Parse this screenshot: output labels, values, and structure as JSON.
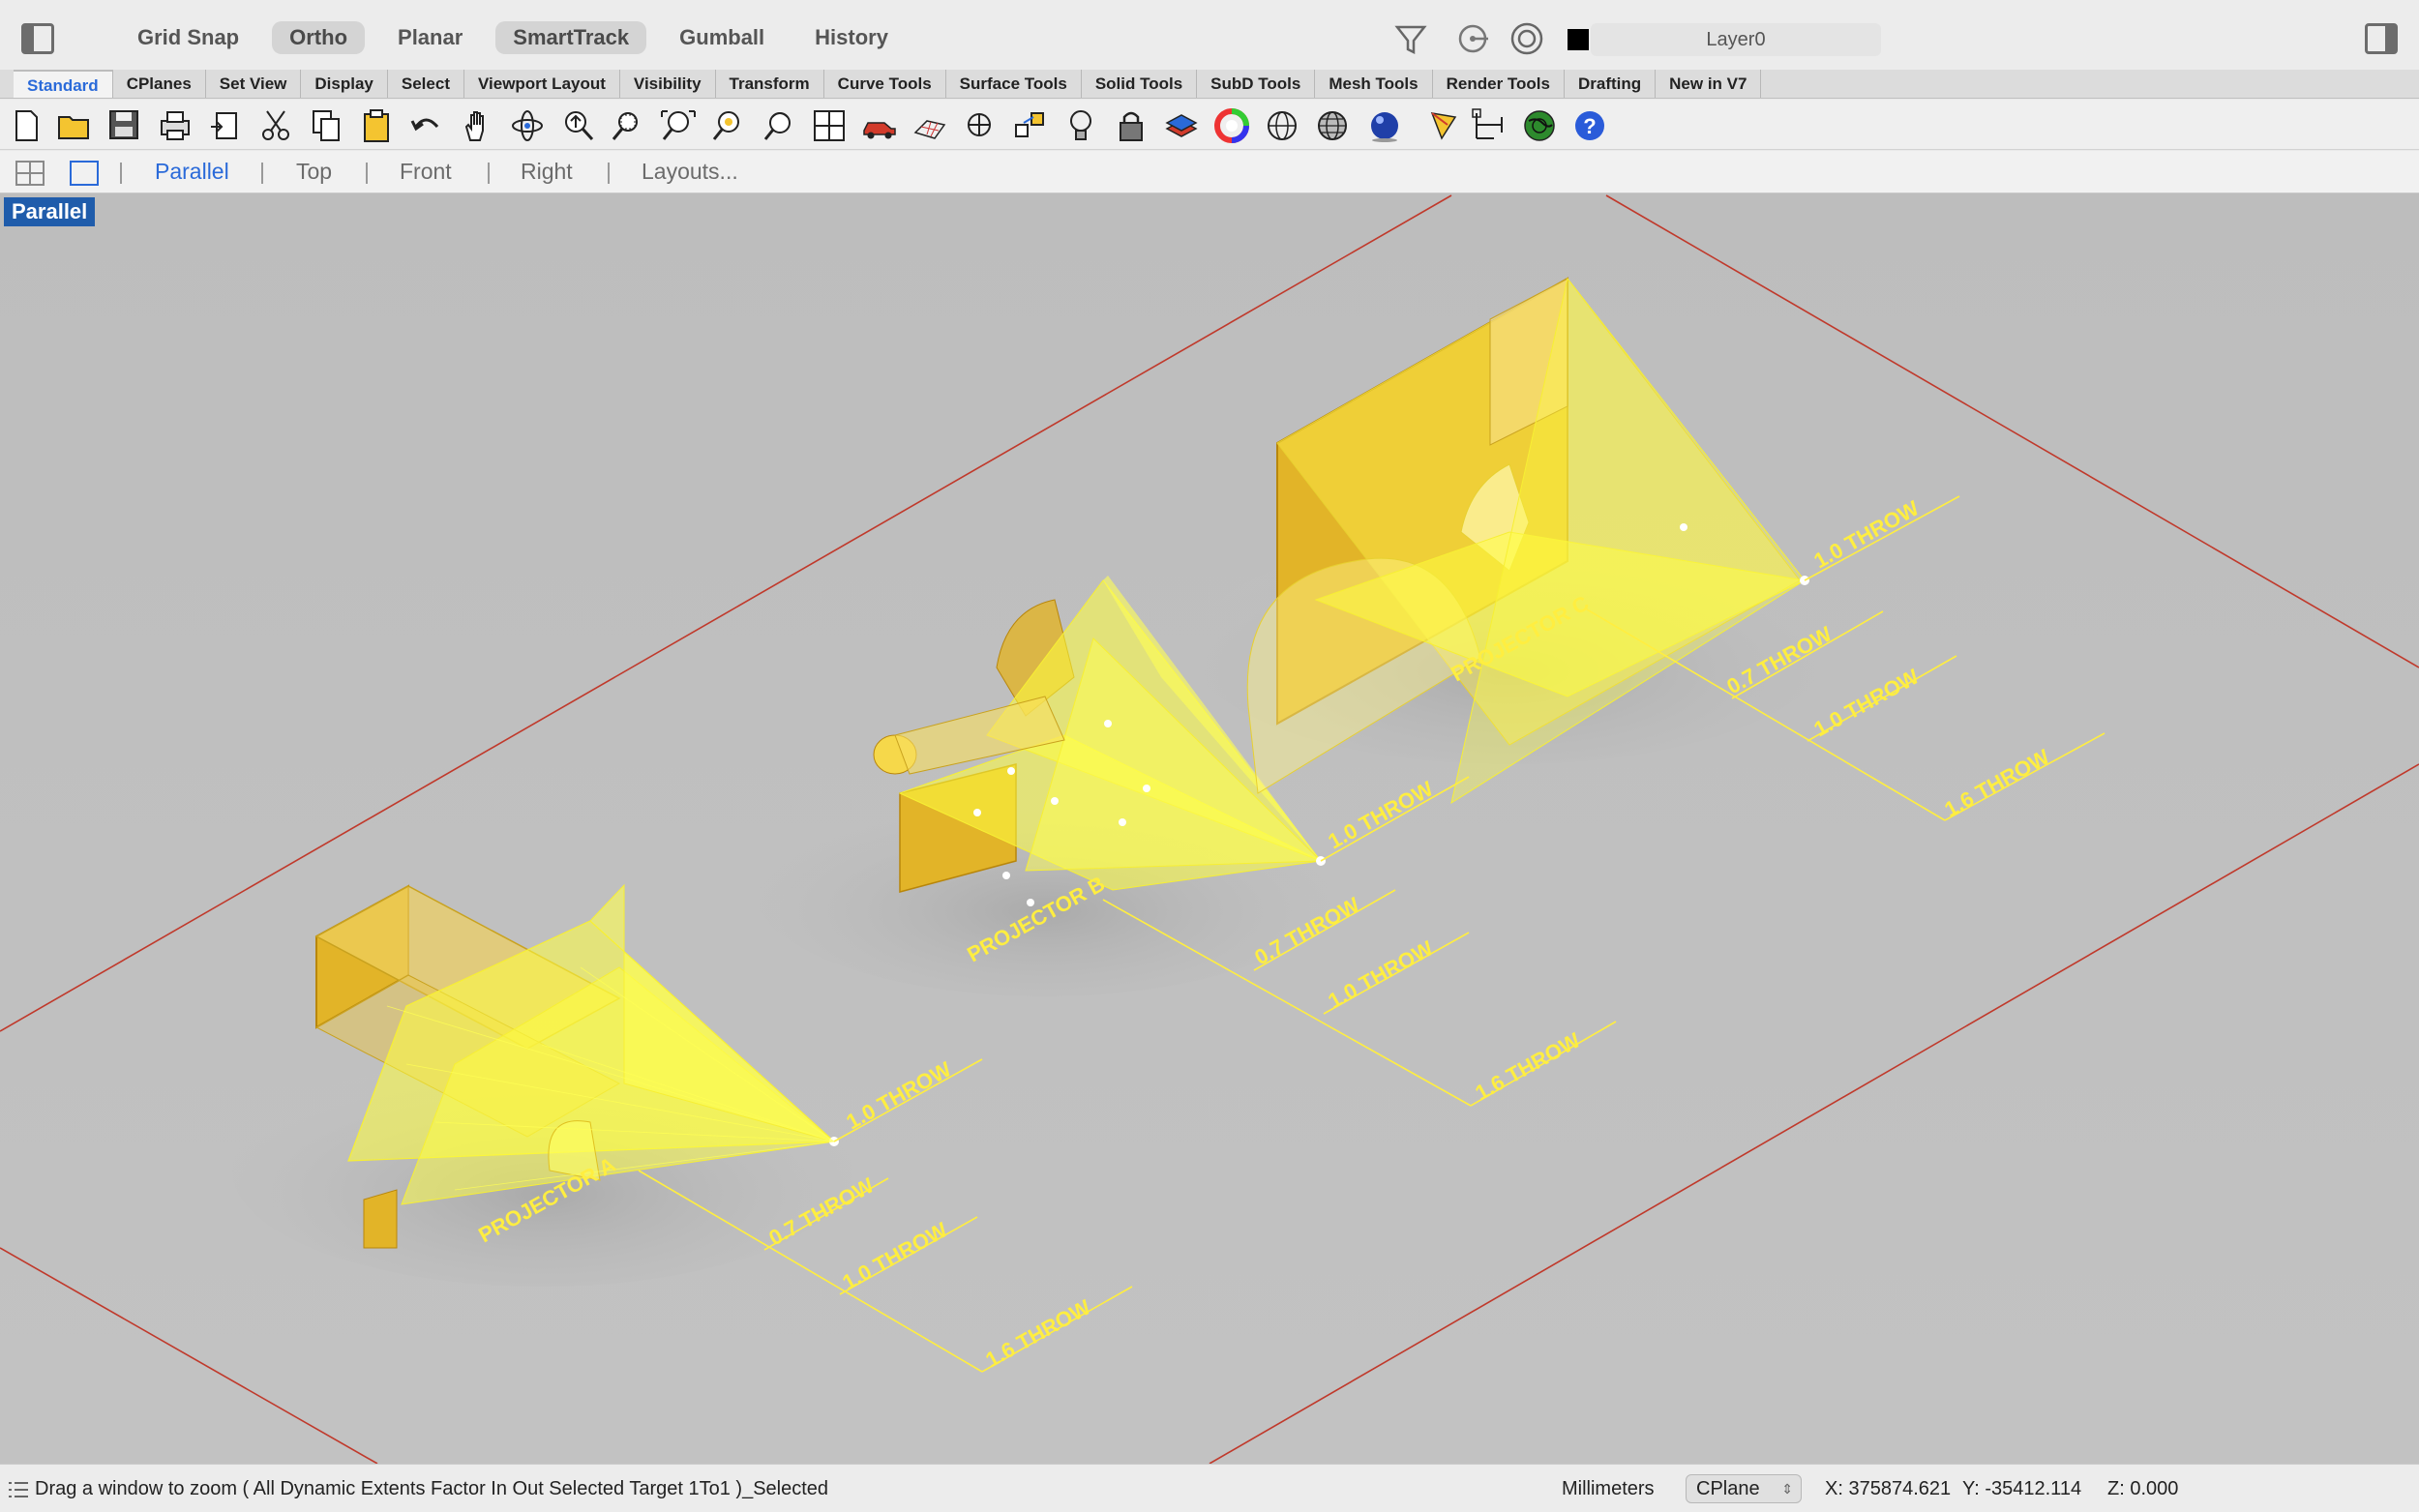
{
  "topbar": {
    "osnaps": [
      "Grid Snap",
      "Ortho",
      "Planar",
      "SmartTrack",
      "Gumball",
      "History"
    ],
    "osnaps_on": [
      "Ortho",
      "SmartTrack"
    ],
    "layer": "Layer0",
    "icons": [
      "left-sidebar-icon",
      "filter-icon",
      "snap-target-icon",
      "record-icon",
      "right-sidebar-icon"
    ]
  },
  "tabs": [
    "Standard",
    "CPlanes",
    "Set View",
    "Display",
    "Select",
    "Viewport Layout",
    "Visibility",
    "Transform",
    "Curve Tools",
    "Surface Tools",
    "Solid Tools",
    "SubD Tools",
    "Mesh Tools",
    "Render Tools",
    "Drafting",
    "New in V7"
  ],
  "active_tab": "Standard",
  "toolbar_icons": [
    "new-icon",
    "open-icon",
    "save-icon",
    "print-icon",
    "import-icon",
    "cut-icon",
    "copy-icon",
    "paste-icon",
    "undo-icon",
    "pan-icon",
    "rotate-view-icon",
    "zoom-dynamic-icon",
    "zoom-window-icon",
    "zoom-extents-icon",
    "zoom-selected-icon",
    "undo-view-icon",
    "four-viewports-icon",
    "car-icon",
    "grid-surface-icon",
    "point-icon",
    "move-icon",
    "light-icon",
    "lock-icon",
    "layer-icon",
    "color-wheel-icon",
    "wireframe-sphere-icon",
    "shaded-sphere-icon",
    "render-sphere-icon",
    "render-icon",
    "dimension-icon",
    "globe-icon",
    "help-icon"
  ],
  "viewbar": {
    "items": [
      "Parallel",
      "Top",
      "Front",
      "Right",
      "Layouts..."
    ],
    "active": "Parallel"
  },
  "viewport": {
    "label": "Parallel",
    "labels": {
      "proj_a": "PROJECTOR A",
      "proj_b": "PROJECTOR B",
      "proj_c": "PROJECTOR C",
      "throw_07": "0.7 THROW",
      "throw_10": "1.0 THROW",
      "throw_16": "1.6 THROW"
    },
    "colors": {
      "beam": "#ffff33",
      "box": "#e7b72a",
      "plane_edge": "#c0392b"
    }
  },
  "status": {
    "prompt": "Drag a window to zoom ( All Dynamic Extents Factor In Out Selected Target 1To1 )_Selected",
    "units": "Millimeters",
    "cplane": "CPlane",
    "x": "X: 375874.621",
    "y": "Y: -35412.114",
    "z": "Z: 0.000"
  }
}
